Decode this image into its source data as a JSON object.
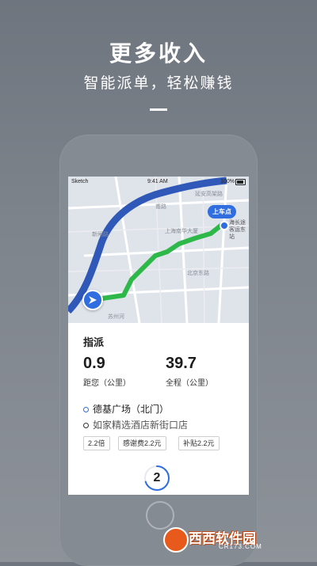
{
  "promo": {
    "headline": "更多收入",
    "subline": "智能派单，轻松赚钱"
  },
  "statusbar": {
    "carrier": "Sketch",
    "time": "9:41 AM",
    "battery": "100%"
  },
  "map": {
    "labels": [
      "延安高架路",
      "甫路",
      "上海南华大厦",
      "北京东路",
      "新闸路",
      "苏州河"
    ],
    "pickup_label": "上车点",
    "destination_label": "海长途客运东站",
    "route_color": "#2fb84a",
    "river_color": "#2f58b8"
  },
  "dispatch": {
    "title": "指派",
    "distance_to_you": "0.9",
    "distance_to_you_label": "距您（公里）",
    "total_distance": "39.7",
    "total_distance_label": "全程（公里）",
    "origin": "德基广场（北门）",
    "destination": "如家精选酒店新街口店",
    "tags": [
      "2.2倍",
      "感谢费2.2元",
      "补贴2.2元"
    ],
    "countdown": "2",
    "countdown_progress": 0.7,
    "accent_color": "#2f6de1"
  },
  "watermark": {
    "brand": "西西软件园",
    "domain": "CR173.COM"
  }
}
